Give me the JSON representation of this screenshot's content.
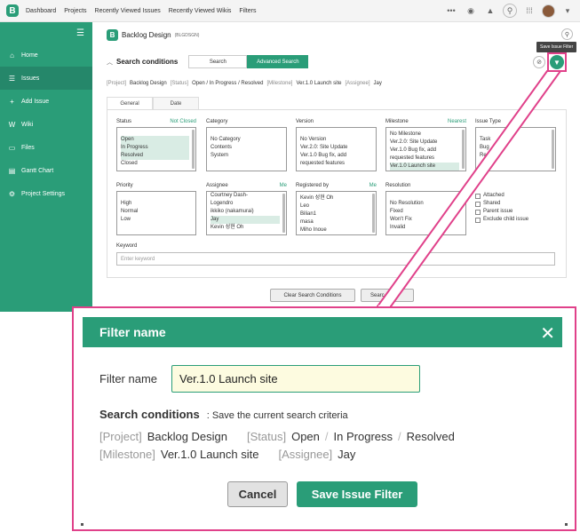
{
  "topbar": {
    "logo": "B",
    "nav": [
      "Dashboard",
      "Projects",
      "Recently Viewed Issues",
      "Recently Viewed Wikis",
      "Filters"
    ]
  },
  "sidebar": {
    "items": [
      {
        "label": "Home",
        "icon": "home-icon",
        "glyph": "⌂"
      },
      {
        "label": "Issues",
        "icon": "list-icon",
        "glyph": "☰"
      },
      {
        "label": "Add Issue",
        "icon": "plus-icon",
        "glyph": "+"
      },
      {
        "label": "Wiki",
        "icon": "wiki-icon",
        "glyph": "W"
      },
      {
        "label": "Files",
        "icon": "folder-icon",
        "glyph": "▭"
      },
      {
        "label": "Gantt Chart",
        "icon": "gantt-icon",
        "glyph": "▤"
      },
      {
        "label": "Project Settings",
        "icon": "gear-icon",
        "glyph": "⚙"
      }
    ]
  },
  "project": {
    "name": "Backlog Design",
    "key": "(BLGDSGN)",
    "logo": "B"
  },
  "tooltip": "Save Issue Filter",
  "search": {
    "title": "Search conditions",
    "mode_search": "Search",
    "mode_advanced": "Advanced Search",
    "crumbs": [
      {
        "tag": "[Project]",
        "val": "Backlog Design"
      },
      {
        "tag": "[Status]",
        "val": "Open / In Progress / Resolved"
      },
      {
        "tag": "[Milestone]",
        "val": "Ver.1.0 Launch site"
      },
      {
        "tag": "[Assignee]",
        "val": "Jay"
      }
    ],
    "tabs": [
      "General",
      "Date"
    ],
    "status": {
      "label": "Status",
      "extra": "Not Closed",
      "items": [
        "Open",
        "In Progress",
        "Resolved",
        "Closed"
      ]
    },
    "category": {
      "label": "Category",
      "items": [
        "No Category",
        "Contents",
        "System"
      ]
    },
    "version": {
      "label": "Version",
      "items": [
        "No Version",
        "Ver.2.0: Site Update",
        "Ver.1.0 Bug fix, add",
        "requested features"
      ]
    },
    "milestone": {
      "label": "Milestone",
      "extra": "Nearest",
      "items": [
        "No Milestone",
        "Ver.2.0: Site Update",
        "Ver.1.0 Bug fix, add",
        "requested features",
        "Ver.1.0 Launch site"
      ]
    },
    "issue_type": {
      "label": "Issue Type",
      "items": [
        "Task",
        "Bug",
        "Re"
      ]
    },
    "priority": {
      "label": "Priority",
      "items": [
        "High",
        "Normal",
        "Low"
      ]
    },
    "assignee": {
      "label": "Assignee",
      "extra": "Me",
      "items": [
        "Courtney Dash-",
        "Logendro",
        "ikkiko (nakamurai)",
        "Jay",
        "Kevin 성현 Oh"
      ]
    },
    "registered": {
      "label": "Registered by",
      "extra": "Me",
      "items": [
        "Kevin 성현 Oh",
        "Leo",
        "Bilian1",
        "masa",
        "Miho Inoue"
      ]
    },
    "resolution": {
      "label": "Resolution",
      "items": [
        "No Resolution",
        "Fixed",
        "Won't Fix",
        "Invalid"
      ]
    },
    "checks": [
      "Attached",
      "Shared",
      "Parent issue",
      "Exclude child issue"
    ],
    "keyword_label": "Keyword",
    "keyword_placeholder": "Enter keyword",
    "clear_label": "Clear Search Conditions",
    "search_label": "Searc"
  },
  "modal": {
    "title": "Filter name",
    "close": "✕",
    "field_label": "Filter name",
    "field_value": "Ver.1.0 Launch site",
    "sc_title": "Search conditions",
    "sc_note": ": Save the current search criteria",
    "line1": [
      {
        "tag": "[Project]",
        "val": "Backlog Design"
      },
      {
        "tag": "[Status]",
        "val": "Open"
      },
      {
        "tag": "/",
        "val": "In Progress"
      },
      {
        "tag": "/",
        "val": "Resolved"
      }
    ],
    "line2": [
      {
        "tag": "[Milestone]",
        "val": "Ver.1.0 Launch site"
      },
      {
        "tag": "[Assignee]",
        "val": "Jay"
      }
    ],
    "cancel": "Cancel",
    "save": "Save Issue Filter"
  },
  "colors": {
    "brand": "#2a9d78",
    "highlight": "#e0418a"
  }
}
